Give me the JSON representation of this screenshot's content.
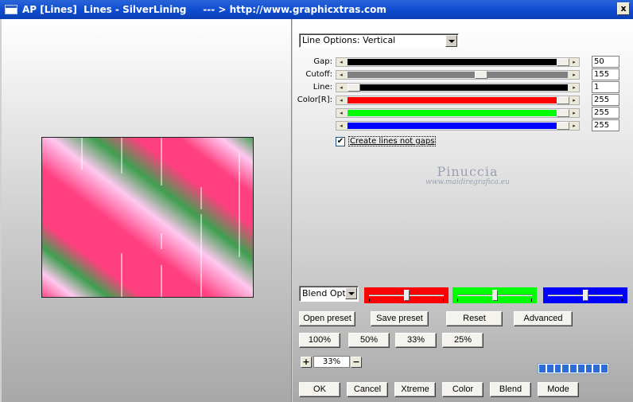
{
  "window": {
    "title": "AP [Lines]  Lines - SilverLining     --- > http://www.graphicxtras.com",
    "close_label": "x"
  },
  "line_options": {
    "selected": "Line Options: Vertical"
  },
  "sliders": [
    {
      "label": "Gap:",
      "value": "50",
      "fill": "#000000",
      "thumb_pct": 100
    },
    {
      "label": "Cutoff:",
      "value": "155",
      "fill": "#808080",
      "thumb_pct": 61
    },
    {
      "label": "Line:",
      "value": "1",
      "fill": "#000000",
      "thumb_pct": 0
    },
    {
      "label": "Color[R]:",
      "value": "255",
      "fill": "#ff0000",
      "thumb_pct": 100
    },
    {
      "label": "",
      "value": "255",
      "fill": "#00ff00",
      "thumb_pct": 100
    },
    {
      "label": "",
      "value": "255",
      "fill": "#0000ff",
      "thumb_pct": 100
    }
  ],
  "checkbox": {
    "label": "Create lines not gaps",
    "checked": true,
    "mark": "✔"
  },
  "watermark": {
    "name": "Pinuccia",
    "url": "www.maidiregrafica.eu"
  },
  "blend_options": {
    "selected": "Blend Optio"
  },
  "color_sliders": [
    {
      "color": "#ff0000",
      "pos_pct": 50
    },
    {
      "color": "#00ff00",
      "pos_pct": 50
    },
    {
      "color": "#0000ff",
      "pos_pct": 50
    }
  ],
  "buttons_row1": [
    "Open preset",
    "Save preset",
    "Reset",
    "Advanced"
  ],
  "buttons_zoom": [
    "100%",
    "50%",
    "33%",
    "25%"
  ],
  "zoom": {
    "plus": "+",
    "value": "33%",
    "minus": "−"
  },
  "progress_segments": 9,
  "buttons_bottom": [
    "OK",
    "Cancel",
    "Xtreme",
    "Color",
    "Blend",
    "Mode"
  ],
  "colors": {
    "pink": "#ff3f7f",
    "light_pink": "#ffc8f0",
    "green": "#3f9f50",
    "title_blue": "#0f4ed0"
  }
}
